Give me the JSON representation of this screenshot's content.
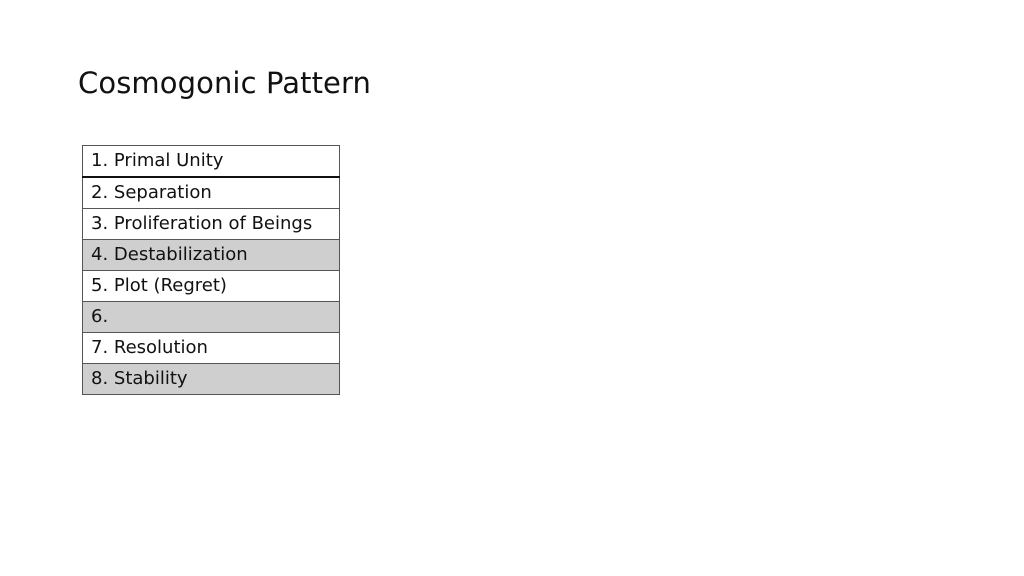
{
  "title": "Cosmogonic Pattern",
  "table": {
    "rows": [
      {
        "label": "1. Primal Unity",
        "shaded": false
      },
      {
        "label": "2. Separation",
        "shaded": false
      },
      {
        "label": "3. Proliferation of Beings",
        "shaded": false
      },
      {
        "label": "4. Destabilization",
        "shaded": true
      },
      {
        "label": "5. Plot (Regret)",
        "shaded": false
      },
      {
        "label": "6.",
        "shaded": true
      },
      {
        "label": "7. Resolution",
        "shaded": false
      },
      {
        "label": "8. Stability",
        "shaded": true
      }
    ]
  },
  "colors": {
    "shaded_row": "#cfcfcf",
    "border": "#555555"
  }
}
